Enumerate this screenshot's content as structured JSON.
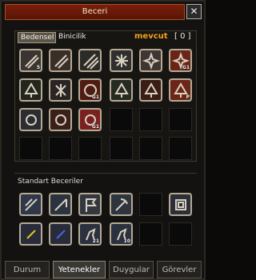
{
  "window": {
    "title": "Beceri",
    "close": "✕"
  },
  "topTabs": [
    {
      "label": "Bedensel",
      "active": true
    },
    {
      "label": "Binicilik",
      "active": false
    }
  ],
  "points": {
    "label": "mevcut",
    "value": "[ 0 ]"
  },
  "skills": [
    {
      "icon": "sword-slash-icon",
      "badge": "5"
    },
    {
      "icon": "double-blade-icon",
      "badge": ""
    },
    {
      "icon": "triple-blade-icon",
      "badge": ""
    },
    {
      "icon": "ice-star-icon",
      "badge": ""
    },
    {
      "icon": "spin-star-icon",
      "badge": ""
    },
    {
      "icon": "flame-burst-icon",
      "badge": "G1"
    },
    {
      "icon": "tree-icon",
      "badge": ""
    },
    {
      "icon": "shatter-icon",
      "badge": ""
    },
    {
      "icon": "sun-burst-icon",
      "badge": "G1"
    },
    {
      "icon": "forest-icon",
      "badge": ""
    },
    {
      "icon": "tree-dark-icon",
      "badge": ""
    },
    {
      "icon": "red-tree-icon",
      "badge": "P"
    },
    {
      "icon": "swirl-icon",
      "badge": ""
    },
    {
      "icon": "dragon-swirl-icon",
      "badge": ""
    },
    {
      "icon": "red-swirl-icon",
      "badge": "G1"
    }
  ],
  "standardSection": {
    "title": "Standart Beceriler"
  },
  "standardSkills": [
    {
      "icon": "arrows-icon",
      "badge": ""
    },
    {
      "icon": "fishing-rod-icon",
      "badge": ""
    },
    {
      "icon": "flag-icon",
      "badge": ""
    },
    {
      "icon": "pickaxe-icon",
      "badge": ""
    },
    {
      "icon": "empty-slot",
      "badge": ""
    },
    {
      "icon": "knot-icon",
      "badge": ""
    },
    {
      "icon": "yellow-scroll-icon",
      "badge": ""
    },
    {
      "icon": "blue-scroll-icon",
      "badge": ""
    },
    {
      "icon": "horse-icon",
      "badge": "21"
    },
    {
      "icon": "horse-mount-icon",
      "badge": "10"
    },
    {
      "icon": "empty-slot",
      "badge": ""
    },
    {
      "icon": "empty-slot",
      "badge": ""
    }
  ],
  "bottomTabs": [
    {
      "label": "Durum",
      "active": false
    },
    {
      "label": "Yetenekler",
      "active": true
    },
    {
      "label": "Duygular",
      "active": false
    },
    {
      "label": "Görevler",
      "active": false
    }
  ]
}
